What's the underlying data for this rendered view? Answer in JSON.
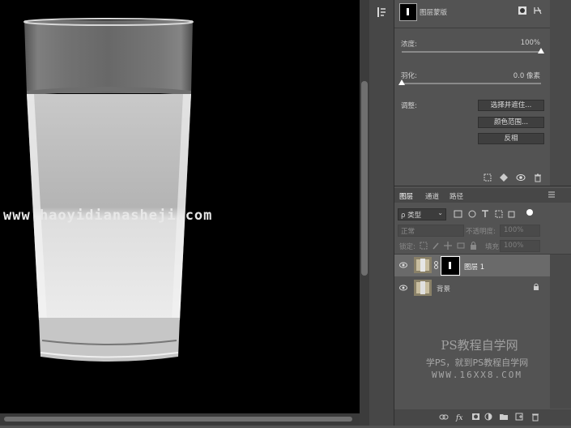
{
  "canvas": {
    "watermark": "www.haoyidianasheji.com"
  },
  "properties": {
    "mask_title": "图层蒙版",
    "density_label": "浓度:",
    "density_value": "100%",
    "density_fraction": 1.0,
    "feather_label": "羽化:",
    "feather_value": "0.0 像素",
    "feather_fraction": 0.0,
    "adjust_label": "调整:",
    "btn_select_mask": "选择并遮住...",
    "btn_color_range": "颜色范围...",
    "btn_invert": "反相"
  },
  "layers_panel": {
    "tabs": [
      "图层",
      "通道",
      "路径"
    ],
    "filter_label": "ρ 类型",
    "blend_mode": "正常",
    "opacity_label": "不透明度:",
    "opacity_value": "100%",
    "lock_label": "锁定:",
    "fill_label": "填充:",
    "fill_value": "100%",
    "layers": [
      {
        "name": "图层 1",
        "selected": true,
        "has_mask": true
      },
      {
        "name": "背景",
        "selected": false,
        "has_mask": false,
        "locked": true
      }
    ]
  },
  "site_watermark": {
    "title": "PS教程自学网",
    "subtitle": "学PS，就到PS教程自学网",
    "url": "WWW.16XX8.COM"
  },
  "colors": {
    "panel_bg": "#535353",
    "canvas_bg": "#000000",
    "selected_layer": "#6a6a6a"
  }
}
